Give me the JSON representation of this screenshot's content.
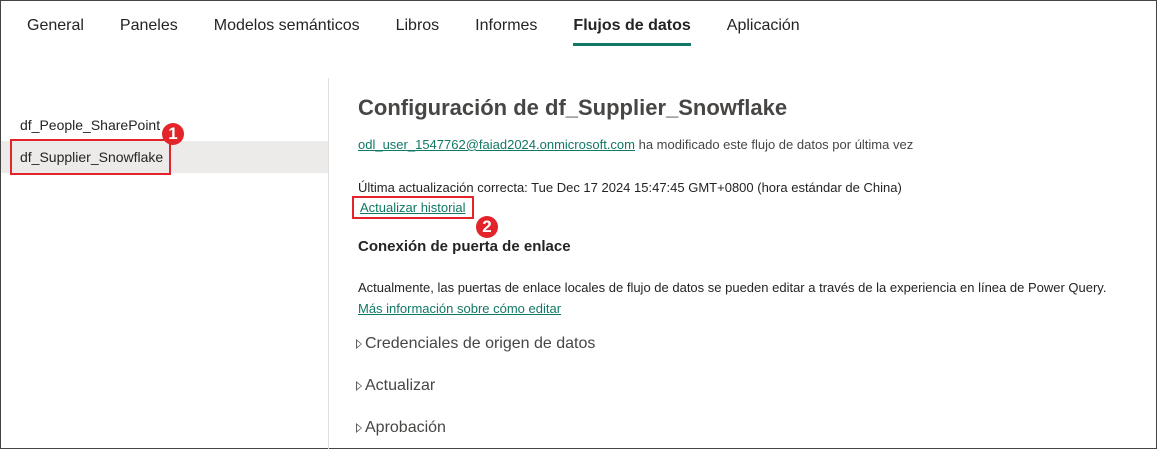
{
  "tabs": [
    {
      "label": "General"
    },
    {
      "label": "Paneles"
    },
    {
      "label": "Modelos semánticos"
    },
    {
      "label": "Libros"
    },
    {
      "label": "Informes"
    },
    {
      "label": "Flujos de datos"
    },
    {
      "label": "Aplicación"
    }
  ],
  "active_tab": "Flujos de datos",
  "dataflows": [
    {
      "name": "df_People_SharePoint"
    },
    {
      "name": "df_Supplier_Snowflake"
    }
  ],
  "markers": {
    "first": "1",
    "second": "2"
  },
  "settings": {
    "title": "Configuración de df_Supplier_Snowflake",
    "modified_user": "odl_user_1547762@faiad2024.onmicrosoft.com",
    "modified_suffix": " ha modificado este flujo de datos por última vez",
    "last_refresh": "Última actualización correcta: Tue Dec 17 2024 15:47:45 GMT+0800 (hora estándar de China)",
    "history_link": "Actualizar historial",
    "gateway_heading": "Conexión de puerta de enlace",
    "gateway_text": "Actualmente, las puertas de enlace locales de flujo de datos se pueden editar a través de la experiencia en línea de Power Query.",
    "gateway_link": "Más información sobre cómo editar",
    "sections": [
      {
        "label": "Credenciales de origen de datos"
      },
      {
        "label": "Actualizar"
      },
      {
        "label": "Aprobación"
      }
    ]
  },
  "colors": {
    "accent": "#117865",
    "highlight": "#e3242b"
  }
}
